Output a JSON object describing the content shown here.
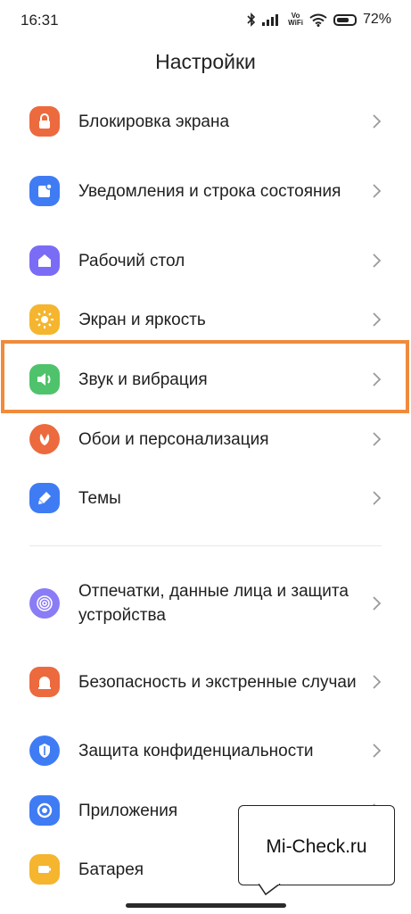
{
  "status_bar": {
    "time": "16:31",
    "vo_top": "Vo",
    "vo_bottom": "WiFi",
    "battery_percent": "72%",
    "battery_level": 0.72,
    "icons": [
      "bluetooth-icon",
      "signal-icon",
      "vowifi-icon",
      "wifi-icon",
      "battery-icon"
    ]
  },
  "header": {
    "title": "Настройки"
  },
  "settings": {
    "items": [
      {
        "label": "Блокировка экрана",
        "icon": "lock-icon",
        "color": "#ec6a3e"
      },
      {
        "label": "Уведомления и строка состояния",
        "icon": "notifications-icon",
        "color": "#3f7cf4"
      },
      {
        "label": "Рабочий стол",
        "icon": "home-icon",
        "color": "#7b6cf6"
      },
      {
        "label": "Экран и яркость",
        "icon": "brightness-icon",
        "color": "#f5b52e"
      },
      {
        "label": "Звук и вибрация",
        "icon": "sound-icon",
        "color": "#4fc36b"
      },
      {
        "label": "Обои и персонализация",
        "icon": "wallpaper-icon",
        "color": "#ec6a3e"
      },
      {
        "label": "Темы",
        "icon": "themes-icon",
        "color": "#3f7cf4"
      },
      {
        "label": "Отпечатки, данные лица и защита устройства",
        "icon": "fingerprint-icon",
        "color": "#8a7cf6"
      },
      {
        "label": "Безопасность и экстренные случаи",
        "icon": "emergency-icon",
        "color": "#ec6a3e"
      },
      {
        "label": "Защита конфиденциальности",
        "icon": "privacy-icon",
        "color": "#3f7cf4"
      },
      {
        "label": "Приложения",
        "icon": "apps-icon",
        "color": "#3f7cf4"
      },
      {
        "label": "Батарея",
        "icon": "battery-app-icon",
        "color": "#f5b52e"
      }
    ]
  },
  "highlight_color": "#f08b3c",
  "watermark": {
    "text": "Mi-Check.ru"
  }
}
